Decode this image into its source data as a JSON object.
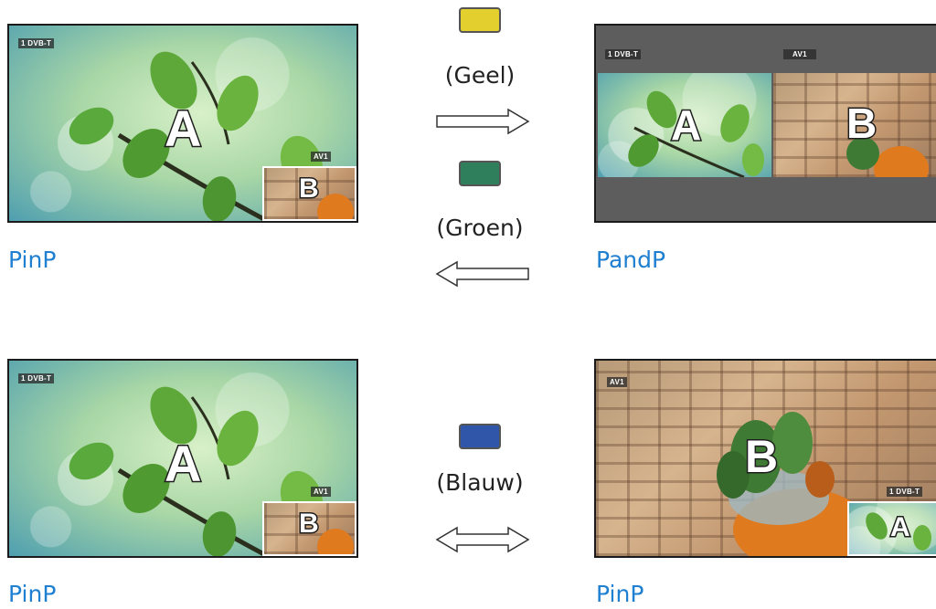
{
  "panels": {
    "top_left": {
      "caption": "PinP",
      "main_tag": "1 DVB-T",
      "sub_tag": "AV1",
      "main_letter": "A",
      "sub_letter": "B"
    },
    "top_right": {
      "caption": "PandP",
      "left_tag": "1 DVB-T",
      "right_tag": "AV1",
      "left_letter": "A",
      "right_letter": "B"
    },
    "bottom_left": {
      "caption": "PinP",
      "main_tag": "1 DVB-T",
      "sub_tag": "AV1",
      "main_letter": "A",
      "sub_letter": "B"
    },
    "bottom_right": {
      "caption": "PinP",
      "main_tag": "AV1",
      "sub_tag": "1 DVB-T",
      "main_letter": "B",
      "sub_letter": "A"
    }
  },
  "buttons": {
    "yellow": {
      "label": "(Geel)",
      "color": "#e3cf2e"
    },
    "green": {
      "label": "(Groen)",
      "color": "#2f7f5c"
    },
    "blue": {
      "label": "(Blauw)",
      "color": "#2f56a8"
    }
  },
  "arrows": {
    "yellow": "right",
    "green": "left",
    "blue": "both"
  }
}
